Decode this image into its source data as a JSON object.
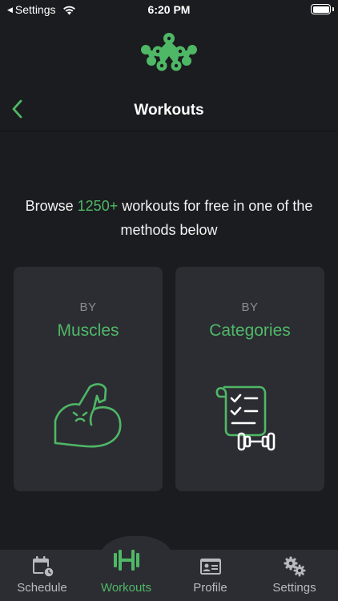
{
  "status_bar": {
    "back_app": "Settings",
    "time": "6:20 PM"
  },
  "header": {
    "title": "Workouts"
  },
  "intro": {
    "prefix": "Browse ",
    "highlight": "1250+",
    "suffix": " workouts for free in one of the methods below"
  },
  "cards": [
    {
      "by": "BY",
      "title": "Muscles",
      "icon": "flexed-bicep-icon"
    },
    {
      "by": "BY",
      "title": "Categories",
      "icon": "checklist-dumbbell-icon"
    }
  ],
  "tabs": [
    {
      "label": "Schedule",
      "icon": "calendar-icon",
      "active": false
    },
    {
      "label": "Workouts",
      "icon": "dumbbell-icon",
      "active": true
    },
    {
      "label": "Profile",
      "icon": "id-card-icon",
      "active": false
    },
    {
      "label": "Settings",
      "icon": "gears-icon",
      "active": false
    }
  ],
  "colors": {
    "accent": "#4fb866",
    "background": "#1b1c1f",
    "card": "#2c2d33",
    "muted": "#8a8b90"
  }
}
